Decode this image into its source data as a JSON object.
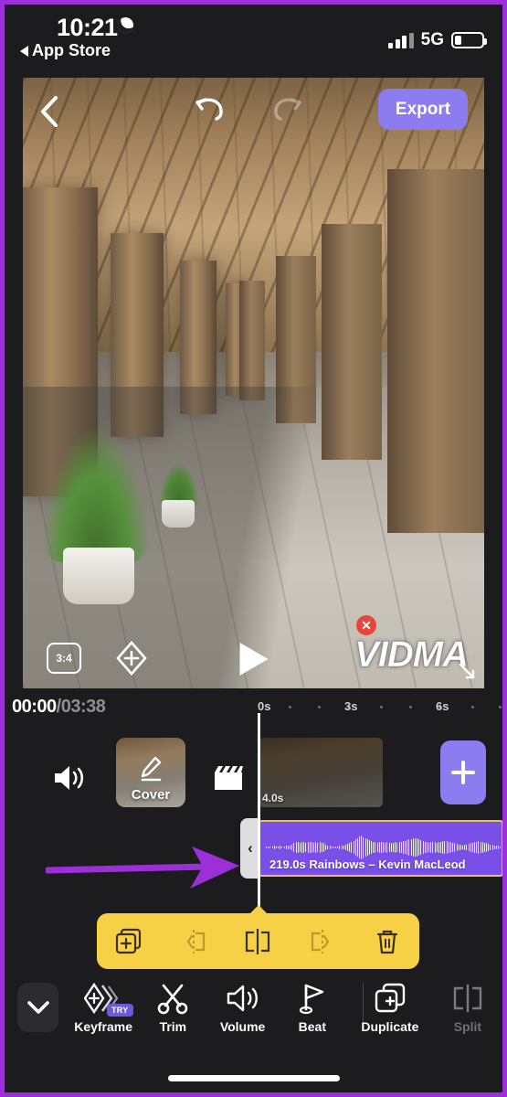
{
  "status_bar": {
    "time": "10:21",
    "moon_icon": "moon-icon",
    "back_label": "App Store",
    "network": "5G",
    "signal_icon": "signal-bars-icon",
    "battery_icon": "battery-low-icon"
  },
  "preview": {
    "back_icon": "chevron-left-icon",
    "undo_icon": "undo-icon",
    "redo_icon": "redo-icon",
    "export_label": "Export",
    "ratio_label": "3:4",
    "keyframe_icon": "keyframe-diamond-icon",
    "play_icon": "play-icon",
    "watermark_text": "VIDMA",
    "watermark_close_icon": "close-icon",
    "watermark_resize_icon": "resize-handle-icon"
  },
  "ruler": {
    "current_time": "00:00",
    "total_time": "/03:38",
    "ticks": [
      "0s",
      "3s",
      "6s"
    ]
  },
  "tracks": {
    "mute_icon": "speaker-icon",
    "cover_label": "Cover",
    "cover_edit_icon": "pencil-icon",
    "clapper_icon": "clapperboard-icon",
    "video_clip_duration": "4.0s",
    "add_icon": "plus-icon",
    "audio_clip_label": "219.0s Rainbows – Kevin MacLeod",
    "trim_handle_icon": "chevron-left-icon"
  },
  "context_toolbar": {
    "background_color": "#f7d145",
    "items": [
      {
        "name": "copy-button",
        "icon": "copy-plus-icon",
        "enabled": true
      },
      {
        "name": "trim-left-button",
        "icon": "trim-left-icon",
        "enabled": false
      },
      {
        "name": "split-button",
        "icon": "split-icon",
        "enabled": true
      },
      {
        "name": "trim-right-button",
        "icon": "trim-right-icon",
        "enabled": false
      },
      {
        "name": "delete-button",
        "icon": "trash-icon",
        "enabled": true
      }
    ]
  },
  "bottom_toolbar": {
    "collapse_icon": "chevron-down-icon",
    "tools": [
      {
        "label": "Keyframe",
        "icon": "keyframe-icon",
        "badge": "TRY",
        "enabled": true
      },
      {
        "label": "Trim",
        "icon": "scissors-icon",
        "badge": "",
        "enabled": true
      },
      {
        "label": "Volume",
        "icon": "volume-icon",
        "badge": "",
        "enabled": true
      },
      {
        "label": "Beat",
        "icon": "flag-icon",
        "badge": "",
        "enabled": true
      },
      {
        "label": "Duplicate",
        "icon": "duplicate-icon",
        "badge": "",
        "enabled": true
      },
      {
        "label": "Split",
        "icon": "split-icon",
        "badge": "",
        "enabled": false
      }
    ]
  },
  "colors": {
    "accent_purple": "#8b7cf0",
    "audio_purple": "#7a4fe8",
    "selection_yellow": "#e7c15f",
    "toolbar_yellow": "#f7d145",
    "annotation_purple": "#9b30d9",
    "background": "#1c1c1e"
  }
}
